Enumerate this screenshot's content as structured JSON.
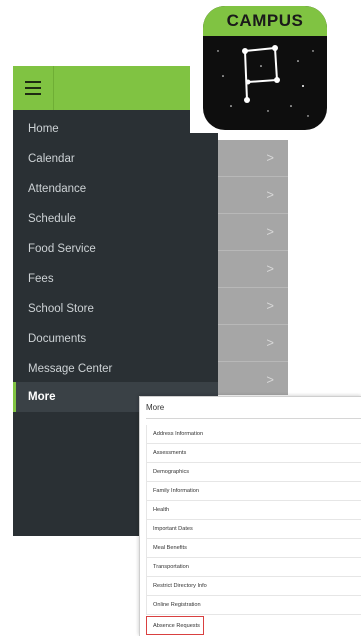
{
  "app_icon": {
    "title": "CAMPUS"
  },
  "drawer": {
    "items": [
      {
        "label": "Home"
      },
      {
        "label": "Calendar"
      },
      {
        "label": "Attendance"
      },
      {
        "label": "Schedule"
      },
      {
        "label": "Food Service"
      },
      {
        "label": "Fees"
      },
      {
        "label": "School Store"
      },
      {
        "label": "Documents"
      },
      {
        "label": "Message Center"
      },
      {
        "label": "More",
        "active": true
      }
    ]
  },
  "bg_list": {
    "chevron": ">"
  },
  "more_panel": {
    "title": "More",
    "items": [
      {
        "label": "Address Information"
      },
      {
        "label": "Assessments"
      },
      {
        "label": "Demographics"
      },
      {
        "label": "Family Information"
      },
      {
        "label": "Health"
      },
      {
        "label": "Important Dates"
      },
      {
        "label": "Meal Benefits"
      },
      {
        "label": "Transportation"
      },
      {
        "label": "Restrict Directory Info"
      },
      {
        "label": "Online Registration"
      },
      {
        "label": "Absence Requests",
        "highlighted": true
      }
    ]
  },
  "colors": {
    "brand_green": "#80c342",
    "drawer_bg": "#2a3034",
    "highlight_red": "#d94040"
  }
}
